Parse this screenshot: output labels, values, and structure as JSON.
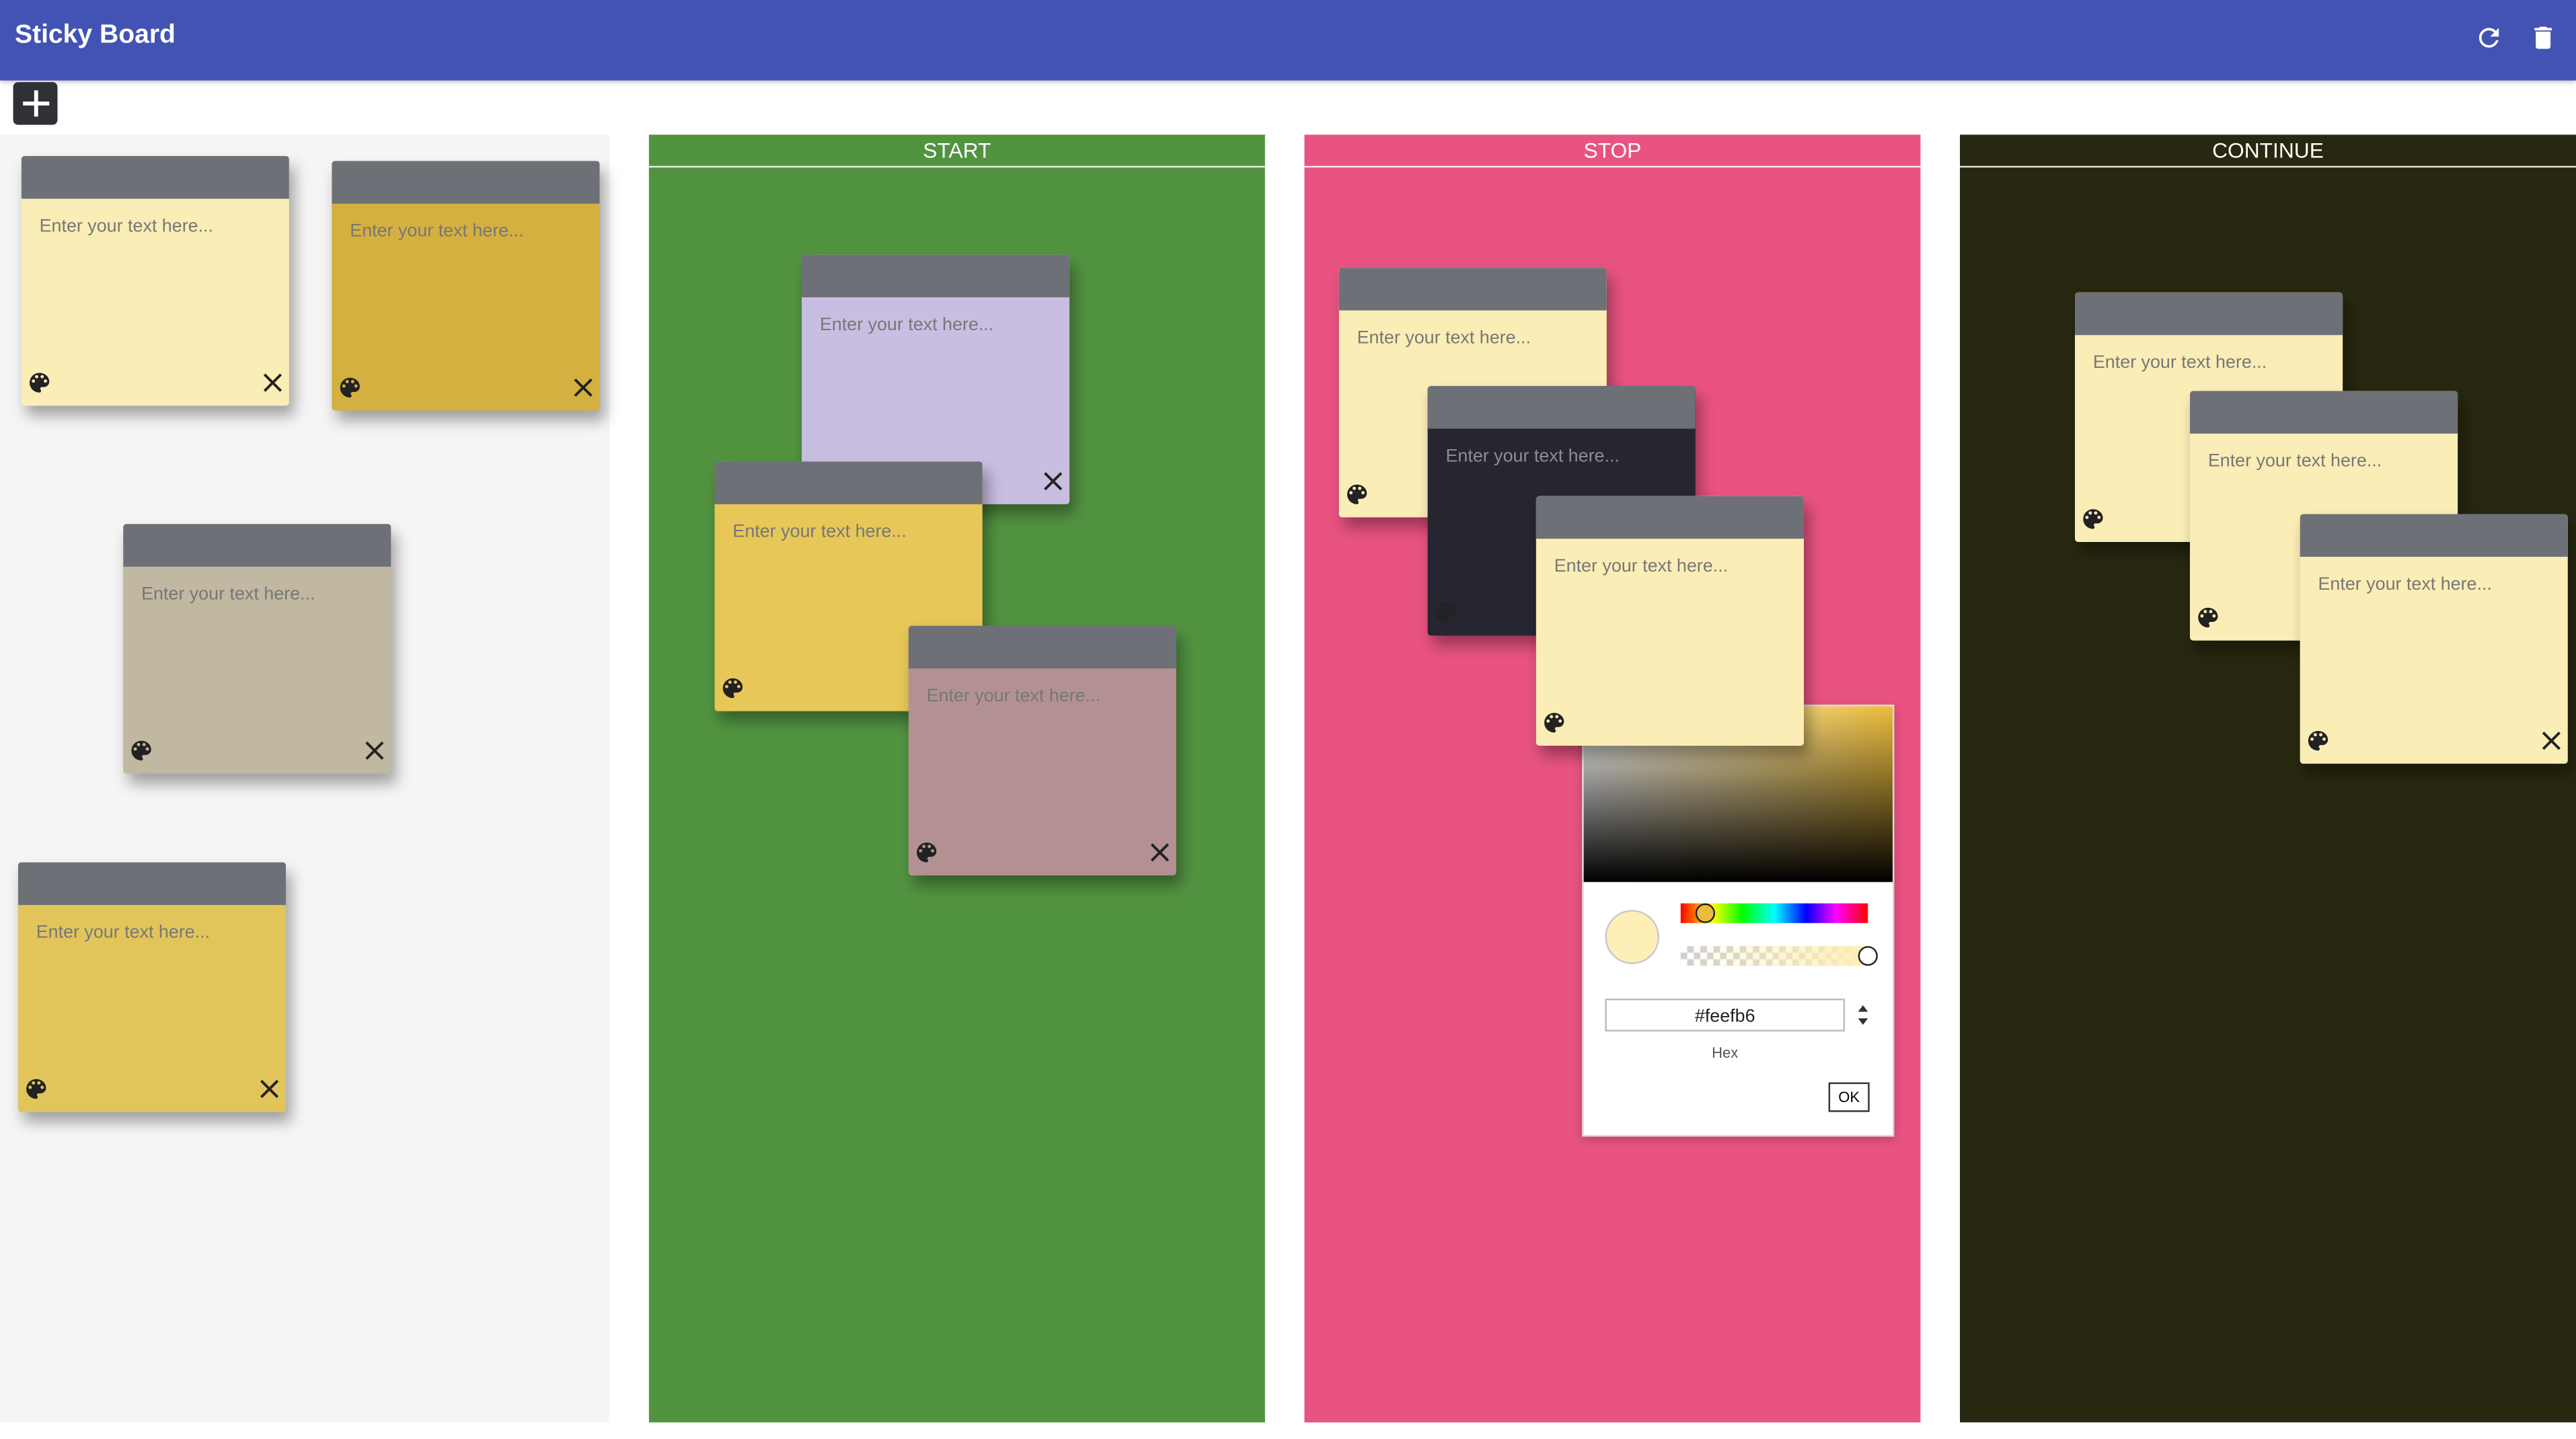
{
  "app": {
    "title": "Sticky Board",
    "colors": {
      "appbar": "#4353b3"
    },
    "toolbar": [
      {
        "icon": "refresh-icon",
        "label": "Refresh"
      },
      {
        "icon": "trash-icon",
        "label": "Delete all"
      }
    ]
  },
  "add_note": {
    "icon": "plus-icon"
  },
  "placeholder": "Enter your text here...",
  "columns": [
    {
      "id": "pool",
      "title": "",
      "color": "#f5f5f5"
    },
    {
      "id": "start",
      "title": "START",
      "color": "#529340"
    },
    {
      "id": "stop",
      "title": "STOP",
      "color": "#e95382"
    },
    {
      "id": "continue",
      "title": "CONTINUE",
      "color": "#27280f"
    }
  ],
  "notes": [
    {
      "column": "pool",
      "color": "#fbedb6",
      "close": true
    },
    {
      "column": "pool",
      "color": "#d4b041",
      "close": true
    },
    {
      "column": "pool",
      "color": "#c0b8a0",
      "close": true
    },
    {
      "column": "pool",
      "color": "#e1c55a",
      "close": true
    },
    {
      "column": "start",
      "color": "#c8bee1",
      "close": true
    },
    {
      "column": "start",
      "color": "#e6c758",
      "close": false
    },
    {
      "column": "start",
      "color": "#b39192",
      "close": true
    },
    {
      "column": "stop",
      "color": "#fbedb6",
      "close": false
    },
    {
      "column": "stop",
      "color": "#262530",
      "close": false
    },
    {
      "column": "stop",
      "color": "#fbedb6",
      "close": false
    },
    {
      "column": "continue",
      "color": "#fbedb6",
      "close": false
    },
    {
      "column": "continue",
      "color": "#fbedb6",
      "close": false
    },
    {
      "column": "continue",
      "color": "#fbedb6",
      "close": true
    }
  ],
  "color_picker": {
    "hex_value": "#feefb6",
    "format_label": "Hex",
    "ok_label": "OK",
    "selected_color": "#feefb6",
    "hue_color": "#ebbc3c"
  }
}
